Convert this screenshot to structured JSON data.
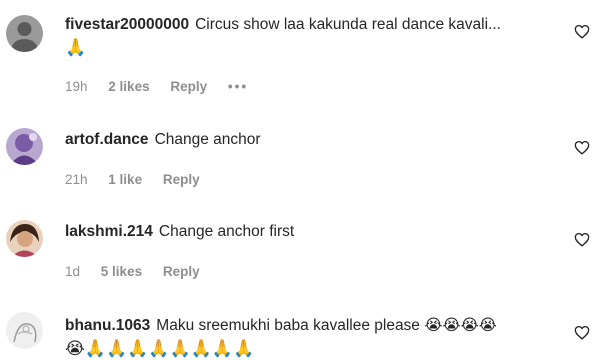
{
  "comments": [
    {
      "username": "fivestar20000000",
      "text": "Circus show laa kakunda real dance kavali...",
      "emoji_line": "🙏",
      "time": "19h",
      "likes": "2 likes",
      "reply": "Reply",
      "more": "•••",
      "avatar_icon": "avatar-placeholder",
      "avatar_color": "#6b6b6b"
    },
    {
      "username": "artof.dance",
      "text": "Change anchor",
      "time": "21h",
      "likes": "1 like",
      "reply": "Reply",
      "avatar_icon": "avatar-photo",
      "avatar_color": "#7b5aa6"
    },
    {
      "username": "lakshmi.214",
      "text": "Change anchor first",
      "time": "1d",
      "likes": "5 likes",
      "reply": "Reply",
      "avatar_icon": "avatar-photo",
      "avatar_color": "#c08a6a"
    },
    {
      "username": "bhanu.1063",
      "text": "Maku sreemukhi baba kavallee please 😭😭😭😭",
      "emoji_line": "😭🙏🙏🙏🙏🙏🙏🙏🙏",
      "avatar_icon": "avatar-sketch",
      "avatar_color": "#d8d8d8"
    }
  ],
  "colors": {
    "text": "#262626",
    "secondary": "#8e8e8e",
    "background": "#ffffff"
  },
  "icons": {
    "like": "heart-outline-icon"
  }
}
